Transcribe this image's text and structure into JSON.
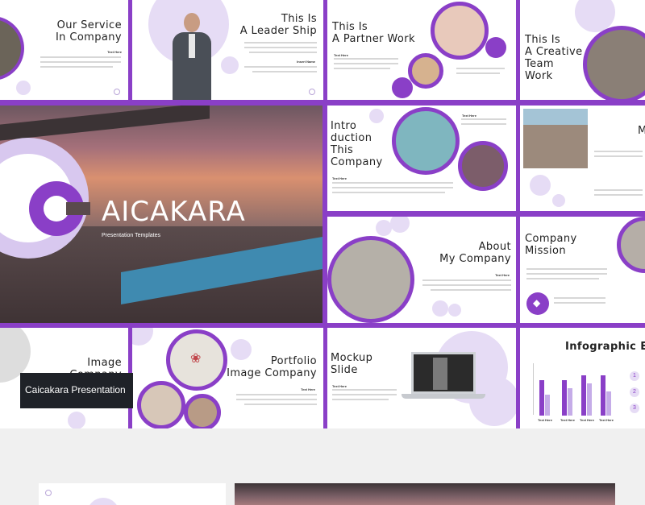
{
  "slides": {
    "our_service": {
      "title_line1": "Our Service",
      "title_line2": "In Company",
      "subhead": "Text Here"
    },
    "leader_ship": {
      "title_line1": "This Is",
      "title_line2": "A Leader Ship",
      "caption": "Insert Name"
    },
    "partner_work": {
      "title_line1": "This Is",
      "title_line2": "A Partner Work",
      "subhead": "Text Here"
    },
    "creative_team": {
      "title_line1": "This Is",
      "title_line2": "A Creative",
      "title_line3": "Team",
      "title_line4": "Work"
    },
    "cover": {
      "brand_rest": "AICAKARA",
      "subtitle": "Presentation Templates"
    },
    "introduction": {
      "title_line1": "Intro",
      "title_line2": "duction",
      "title_line3": "This",
      "title_line4": "Company",
      "subhead_top": "Text Here",
      "subhead_bottom": "Text Here"
    },
    "m_slide": {
      "title": "M"
    },
    "about": {
      "title_line1": "About",
      "title_line2": "My Company",
      "subhead": "Text Here"
    },
    "mission": {
      "title_line1": "Company",
      "title_line2": "Mission"
    },
    "image_company": {
      "title_line1": "Image",
      "title_line2": "Company"
    },
    "portfolio": {
      "title_line1": "Portfolio",
      "title_line2": "Image Company",
      "subhead": "Text Here"
    },
    "mockup": {
      "title_line1": "Mockup",
      "title_line2": "Slide",
      "subhead": "Text Here"
    },
    "infographic": {
      "title": "Infographic Ele",
      "labels": [
        "Text Here",
        "Text Here",
        "Text Here",
        "Text Here"
      ],
      "numbers": [
        "1",
        "2",
        "3"
      ]
    }
  },
  "banner": {
    "label": "Caicakara Presentation"
  },
  "colors": {
    "accent": "#8a3fc7",
    "lavender": "#e6dcf5",
    "banner_bg": "#1f2228"
  },
  "icons": [
    "tag-icon",
    "laptop-icon",
    "leaf-icon"
  ]
}
